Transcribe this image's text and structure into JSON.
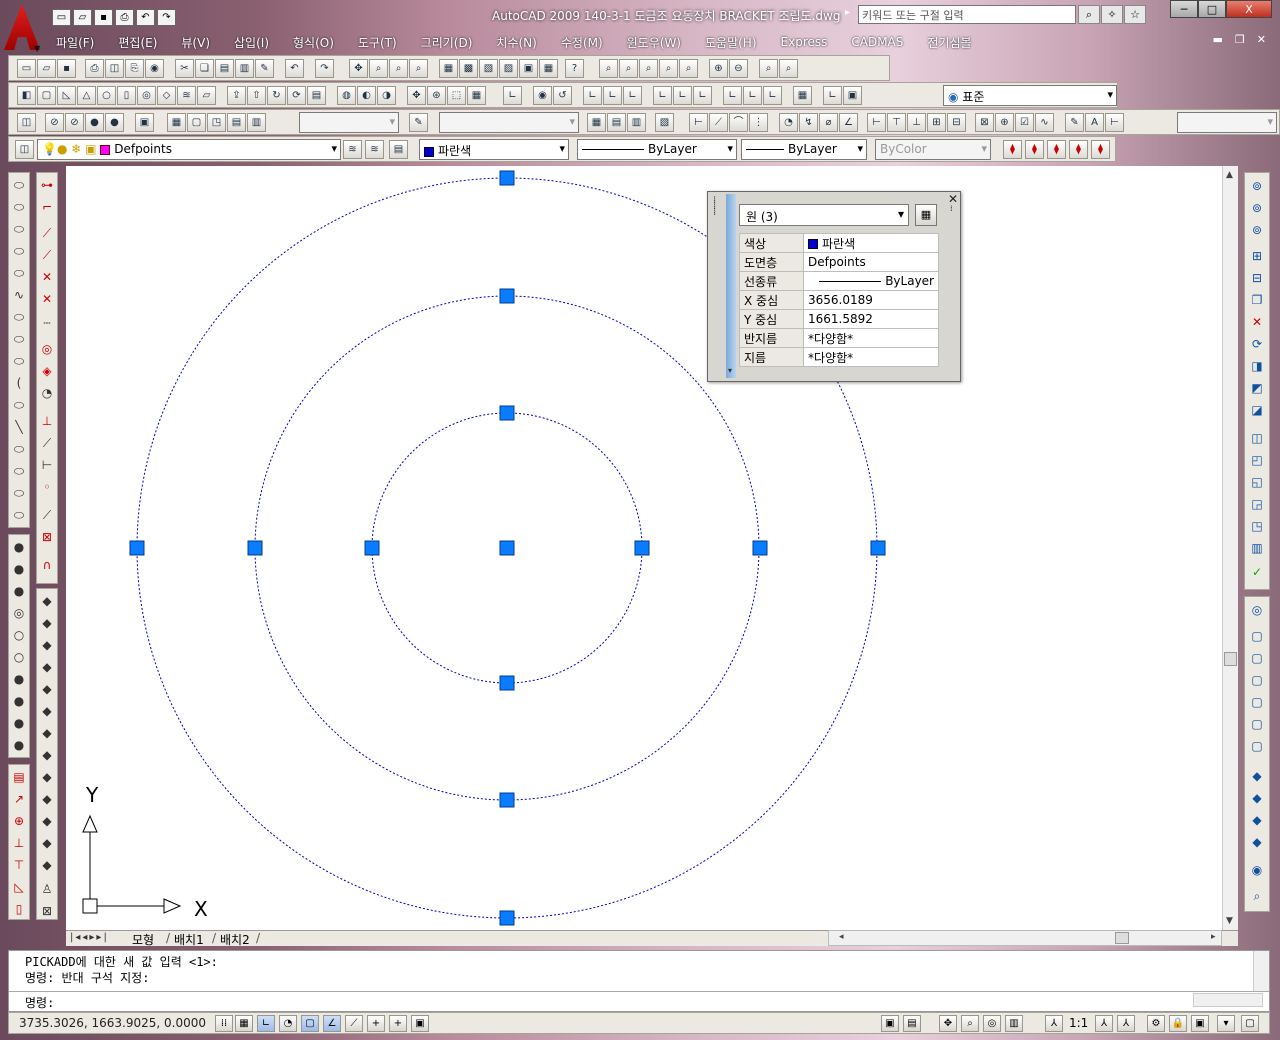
{
  "window": {
    "title": "AutoCAD 2009 140-3-1 도금조 요동장치 BRACKET 조립도.dwg",
    "search_placeholder": "키워드 또는 구절 입력",
    "controls": [
      "─",
      "□",
      "X"
    ]
  },
  "menu": {
    "items": [
      "파일(F)",
      "편집(E)",
      "뷰(V)",
      "삽입(I)",
      "형식(O)",
      "도구(T)",
      "그리기(D)",
      "치수(N)",
      "수정(M)",
      "윈도우(W)",
      "도움말(H)",
      "Express",
      "CADMAS",
      "전기심볼"
    ]
  },
  "toolbar": {
    "visual_style": "표준",
    "layer": "Defpoints",
    "color": "파란색",
    "linetype": "ByLayer",
    "lineweight": "ByLayer",
    "plotstyle": "ByColor",
    "colors": {
      "blue": "#0000c8",
      "layer_magenta": "#ff00ff",
      "grip": "#0a7cff"
    }
  },
  "properties_palette": {
    "selection": "원 (3)",
    "rows": [
      {
        "key": "색상",
        "value": "파란색"
      },
      {
        "key": "도면층",
        "value": "Defpoints"
      },
      {
        "key": "선종류",
        "value": "ByLayer"
      },
      {
        "key": "X 중심",
        "value": "3656.0189"
      },
      {
        "key": "Y 중심",
        "value": "1661.5892"
      },
      {
        "key": "반지름",
        "value": "*다양함*"
      },
      {
        "key": "지름",
        "value": "*다양함*"
      }
    ]
  },
  "layout_tabs": [
    "모형",
    "배치1",
    "배치2"
  ],
  "ucs": {
    "x_label": "X",
    "y_label": "Y"
  },
  "command": {
    "line1": "PICKADD에 대한 새 값 입력 <1>:",
    "line2": "명령: 반대 구석 지정:",
    "prompt": "명령:"
  },
  "status": {
    "coords": "3735.3026, 1663.9025, 0.0000",
    "scale": "1:1"
  }
}
